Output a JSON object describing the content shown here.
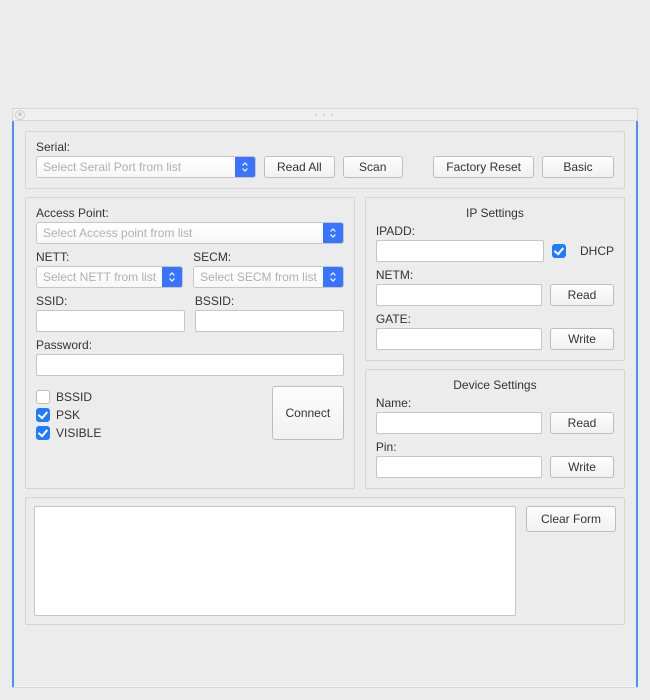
{
  "serial": {
    "label": "Serial:",
    "placeholder": "Select Serail Port from list",
    "read_all": "Read All",
    "scan": "Scan",
    "factory_reset": "Factory Reset",
    "basic": "Basic"
  },
  "ap": {
    "title": "Access Point:",
    "placeholder": "Select Access point from list",
    "nett_label": "NETT:",
    "nett_placeholder": "Select NETT from list",
    "secm_label": "SECM:",
    "secm_placeholder": "Select SECM from list",
    "ssid_label": "SSID:",
    "bssid_label": "BSSID:",
    "password_label": "Password:",
    "chk_bssid": "BSSID",
    "chk_psk": "PSK",
    "chk_visible": "VISIBLE",
    "connect": "Connect"
  },
  "ip": {
    "title": "IP Settings",
    "ipadd": "IPADD:",
    "dhcp": "DHCP",
    "netm": "NETM:",
    "gate": "GATE:",
    "read": "Read",
    "write": "Write"
  },
  "device": {
    "title": "Device Settings",
    "name": "Name:",
    "pin": "Pin:",
    "read": "Read",
    "write": "Write"
  },
  "footer": {
    "clear": "Clear Form"
  }
}
